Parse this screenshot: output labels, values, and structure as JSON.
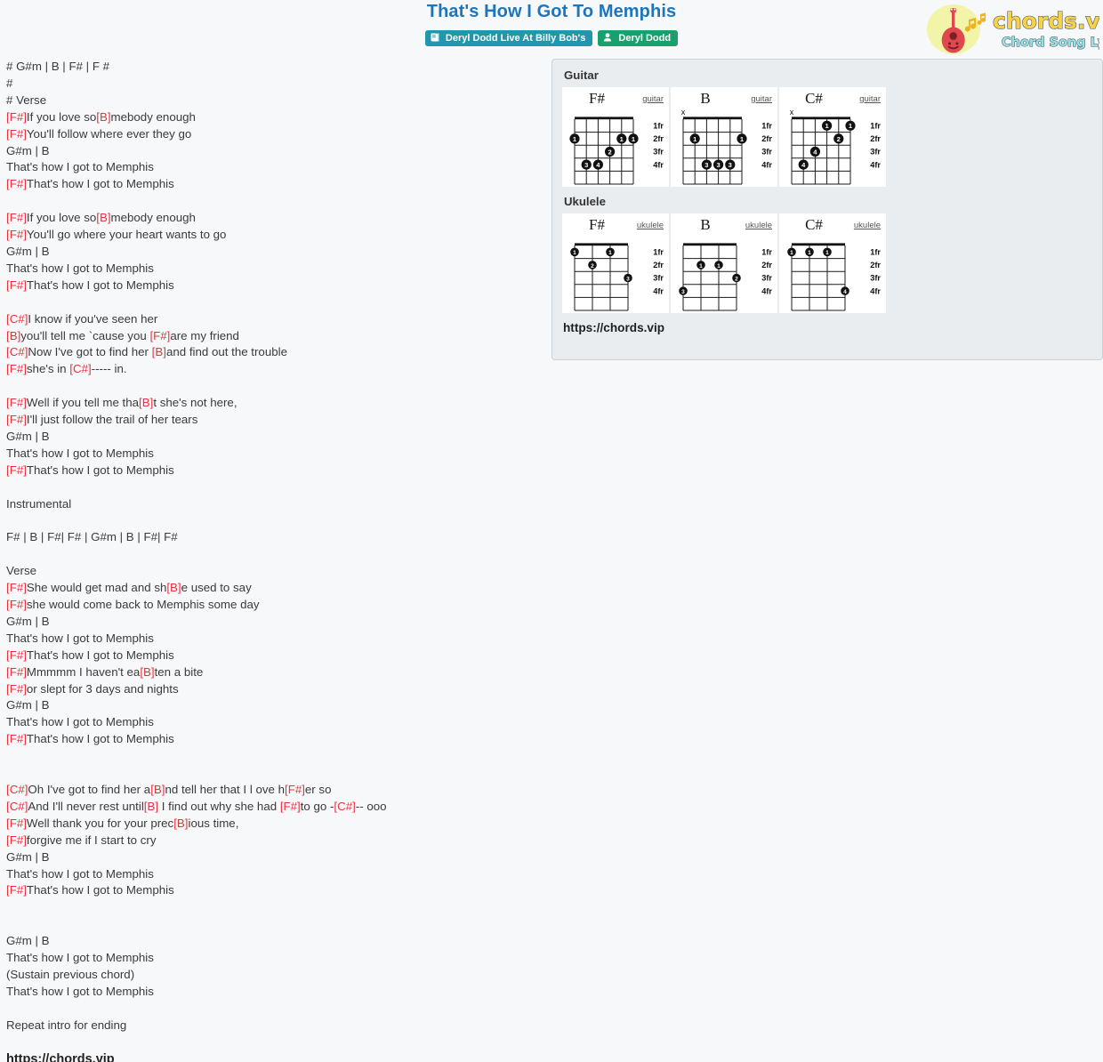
{
  "header": {
    "title": "That's How I Got To Memphis",
    "badges": [
      {
        "label": "Deryl Dodd Live At Billy Bob's",
        "icon": "album-icon",
        "color": "#2196ac"
      },
      {
        "label": "Deryl Dodd",
        "icon": "person-icon",
        "color": "#18a06e"
      }
    ]
  },
  "logo": {
    "brand": "chords.vip",
    "tagline": "Chord Song Lyric",
    "icon": "guitar-icon"
  },
  "lyrics": {
    "lines": [
      [
        {
          "t": "# G#m | B | F# | F #",
          "c": false
        }
      ],
      [
        {
          "t": "#",
          "c": false
        }
      ],
      [
        {
          "t": "# Verse",
          "c": false
        }
      ],
      [
        {
          "t": "[F#]",
          "c": true
        },
        {
          "t": "If you love so",
          "c": false
        },
        {
          "t": "[B]",
          "c": true
        },
        {
          "t": "mebody enough",
          "c": false
        }
      ],
      [
        {
          "t": "[F#]",
          "c": true
        },
        {
          "t": "You'll follow where ever they go",
          "c": false
        }
      ],
      [
        {
          "t": "G#m | B",
          "c": false
        }
      ],
      [
        {
          "t": "That's how I got to Memphis",
          "c": false
        }
      ],
      [
        {
          "t": "[F#]",
          "c": true
        },
        {
          "t": "That's how I got to Memphis",
          "c": false
        }
      ],
      [],
      [
        {
          "t": "[F#]",
          "c": true
        },
        {
          "t": "If you love so",
          "c": false
        },
        {
          "t": "[B]",
          "c": true
        },
        {
          "t": "mebody enough",
          "c": false
        }
      ],
      [
        {
          "t": "[F#]",
          "c": true
        },
        {
          "t": "You'll go where your heart wants to go",
          "c": false
        }
      ],
      [
        {
          "t": "G#m | B",
          "c": false
        }
      ],
      [
        {
          "t": "That's how I got to Memphis",
          "c": false
        }
      ],
      [
        {
          "t": "[F#]",
          "c": true
        },
        {
          "t": "That's how I got to Memphis",
          "c": false
        }
      ],
      [],
      [
        {
          "t": "[C#]",
          "c": true
        },
        {
          "t": "I know if you've seen her",
          "c": false
        }
      ],
      [
        {
          "t": "[B]",
          "c": true
        },
        {
          "t": "you'll tell me `cause you ",
          "c": false
        },
        {
          "t": "[F#]",
          "c": true
        },
        {
          "t": "are my friend",
          "c": false
        }
      ],
      [
        {
          "t": "[C#]",
          "c": true
        },
        {
          "t": "Now I've got to find her ",
          "c": false
        },
        {
          "t": "[B]",
          "c": true
        },
        {
          "t": "and find out the trouble",
          "c": false
        }
      ],
      [
        {
          "t": "[F#]",
          "c": true
        },
        {
          "t": "she's in ",
          "c": false
        },
        {
          "t": "[C#]",
          "c": true
        },
        {
          "t": "----- in.",
          "c": false
        }
      ],
      [],
      [
        {
          "t": "[F#]",
          "c": true
        },
        {
          "t": "Well if you tell me tha",
          "c": false
        },
        {
          "t": "[B]",
          "c": true
        },
        {
          "t": "t she's not here,",
          "c": false
        }
      ],
      [
        {
          "t": "[F#]",
          "c": true
        },
        {
          "t": "I'll just follow the trail of her tears",
          "c": false
        }
      ],
      [
        {
          "t": "G#m | B",
          "c": false
        }
      ],
      [
        {
          "t": "That's how I got to Memphis",
          "c": false
        }
      ],
      [
        {
          "t": "[F#]",
          "c": true
        },
        {
          "t": "That's how I got to Memphis",
          "c": false
        }
      ],
      [],
      [
        {
          "t": "Instrumental",
          "c": false
        }
      ],
      [],
      [
        {
          "t": "F# | B | F#| F# | G#m | B | F#| F#",
          "c": false
        }
      ],
      [],
      [
        {
          "t": "Verse",
          "c": false
        }
      ],
      [
        {
          "t": "[F#]",
          "c": true
        },
        {
          "t": "She would get mad and sh",
          "c": false
        },
        {
          "t": "[B]",
          "c": true
        },
        {
          "t": "e used to say",
          "c": false
        }
      ],
      [
        {
          "t": "[F#]",
          "c": true
        },
        {
          "t": "she would come back to Memphis some day",
          "c": false
        }
      ],
      [
        {
          "t": "G#m | B",
          "c": false
        }
      ],
      [
        {
          "t": "That's how I got to Memphis",
          "c": false
        }
      ],
      [
        {
          "t": "[F#]",
          "c": true
        },
        {
          "t": "That's how I got to Memphis",
          "c": false
        }
      ],
      [
        {
          "t": "[F#]",
          "c": true
        },
        {
          "t": "Mmmmm I haven't ea",
          "c": false
        },
        {
          "t": "[B]",
          "c": true
        },
        {
          "t": "ten a bite",
          "c": false
        }
      ],
      [
        {
          "t": "[F#]",
          "c": true
        },
        {
          "t": "or slept for 3 days and nights",
          "c": false
        }
      ],
      [
        {
          "t": "G#m | B",
          "c": false
        }
      ],
      [
        {
          "t": "That's how I got to Memphis",
          "c": false
        }
      ],
      [
        {
          "t": "[F#]",
          "c": true
        },
        {
          "t": "That's how I got to Memphis",
          "c": false
        }
      ],
      [],
      [],
      [
        {
          "t": "[C#]",
          "c": true
        },
        {
          "t": "Oh I've got to find her a",
          "c": false
        },
        {
          "t": "[B]",
          "c": true
        },
        {
          "t": "nd tell her that I l ove h",
          "c": false
        },
        {
          "t": "[F#]",
          "c": true
        },
        {
          "t": "er so",
          "c": false
        }
      ],
      [
        {
          "t": "[C#]",
          "c": true
        },
        {
          "t": "And I'll never rest until",
          "c": false
        },
        {
          "t": "[B]",
          "c": true
        },
        {
          "t": " I find out why she had ",
          "c": false
        },
        {
          "t": "[F#]",
          "c": true
        },
        {
          "t": "to go -",
          "c": false
        },
        {
          "t": "[C#]",
          "c": true
        },
        {
          "t": "-- ooo",
          "c": false
        }
      ],
      [
        {
          "t": "[F#]",
          "c": true
        },
        {
          "t": "Well thank you for your prec",
          "c": false
        },
        {
          "t": "[B]",
          "c": true
        },
        {
          "t": "ious time,",
          "c": false
        }
      ],
      [
        {
          "t": "[F#]",
          "c": true
        },
        {
          "t": "forgive me if I start to cry",
          "c": false
        }
      ],
      [
        {
          "t": "G#m | B",
          "c": false
        }
      ],
      [
        {
          "t": "That's how I got to Memphis",
          "c": false
        }
      ],
      [
        {
          "t": "[F#]",
          "c": true
        },
        {
          "t": "That's how I got to Memphis",
          "c": false
        }
      ],
      [],
      [],
      [
        {
          "t": "G#m | B",
          "c": false
        }
      ],
      [
        {
          "t": "That's how I got to Memphis",
          "c": false
        }
      ],
      [
        {
          "t": "(Sustain previous chord)",
          "c": false
        }
      ],
      [
        {
          "t": "That's how I got to Memphis",
          "c": false
        }
      ],
      [],
      [
        {
          "t": "Repeat intro for ending",
          "c": false
        }
      ]
    ],
    "footer_url": "https://chords.vip"
  },
  "chord_panel": {
    "sections": [
      {
        "title": "Guitar",
        "instrument_label": "guitar",
        "strings": 6,
        "fret_labels": [
          "1fr",
          "2fr",
          "3fr",
          "4fr"
        ],
        "chords": [
          {
            "name": "F#",
            "muted": [],
            "dots": [
              {
                "string": 6,
                "fret": 2,
                "finger": "1"
              },
              {
                "string": 2,
                "fret": 2,
                "finger": "1"
              },
              {
                "string": 1,
                "fret": 2,
                "finger": "1"
              },
              {
                "string": 3,
                "fret": 3,
                "finger": "2"
              },
              {
                "string": 5,
                "fret": 4,
                "finger": "3"
              },
              {
                "string": 4,
                "fret": 4,
                "finger": "4"
              }
            ]
          },
          {
            "name": "B",
            "muted": [
              6
            ],
            "dots": [
              {
                "string": 5,
                "fret": 2,
                "finger": "1"
              },
              {
                "string": 1,
                "fret": 2,
                "finger": "1"
              },
              {
                "string": 4,
                "fret": 4,
                "finger": "3"
              },
              {
                "string": 3,
                "fret": 4,
                "finger": "3"
              },
              {
                "string": 2,
                "fret": 4,
                "finger": "3"
              }
            ]
          },
          {
            "name": "C#",
            "muted": [
              6
            ],
            "dots": [
              {
                "string": 3,
                "fret": 1,
                "finger": "1"
              },
              {
                "string": 1,
                "fret": 1,
                "finger": "1"
              },
              {
                "string": 2,
                "fret": 2,
                "finger": "2"
              },
              {
                "string": 4,
                "fret": 3,
                "finger": "4"
              },
              {
                "string": 5,
                "fret": 4,
                "finger": "4"
              }
            ]
          }
        ]
      },
      {
        "title": "Ukulele",
        "instrument_label": "ukulele",
        "strings": 4,
        "fret_labels": [
          "1fr",
          "2fr",
          "3fr",
          "4fr"
        ],
        "chords": [
          {
            "name": "F#",
            "muted": [],
            "dots": [
              {
                "string": 4,
                "fret": 1,
                "finger": "1"
              },
              {
                "string": 2,
                "fret": 1,
                "finger": "1"
              },
              {
                "string": 3,
                "fret": 2,
                "finger": "2"
              },
              {
                "string": 1,
                "fret": 3,
                "finger": "3"
              }
            ]
          },
          {
            "name": "B",
            "muted": [],
            "dots": [
              {
                "string": 3,
                "fret": 2,
                "finger": "1"
              },
              {
                "string": 2,
                "fret": 2,
                "finger": "1"
              },
              {
                "string": 1,
                "fret": 3,
                "finger": "2"
              },
              {
                "string": 4,
                "fret": 4,
                "finger": "3"
              }
            ]
          },
          {
            "name": "C#",
            "muted": [],
            "dots": [
              {
                "string": 4,
                "fret": 1,
                "finger": "1"
              },
              {
                "string": 3,
                "fret": 1,
                "finger": "1"
              },
              {
                "string": 2,
                "fret": 1,
                "finger": "1"
              },
              {
                "string": 1,
                "fret": 4,
                "finger": "4"
              }
            ]
          }
        ]
      }
    ],
    "url": "https://chords.vip"
  },
  "colors": {
    "title": "#1d76bc",
    "chord": "#e8323c",
    "badge_album": "#2196ac",
    "badge_artist": "#18a06e",
    "panel_bg": "#e9edf0"
  }
}
